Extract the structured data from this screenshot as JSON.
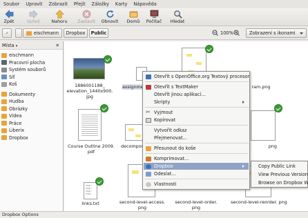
{
  "menubar": [
    "Soubor",
    "Upravit",
    "Zobrazit",
    "Přejít",
    "Záložky",
    "Karty",
    "Nápověda"
  ],
  "toolbar": {
    "back": "Zpět",
    "forward": "Vpřed",
    "up": "Nahoru",
    "stop": "Zastavit",
    "reload": "Obnovit",
    "home": "Domů",
    "computer": "Počítač",
    "search": "Hledat"
  },
  "path": [
    "eischmann",
    "Dropbox",
    "Public"
  ],
  "zoom": "100%",
  "view_mode": "Zobrazení s ikonami",
  "sidebar": {
    "header": "Místa",
    "items": [
      "eischmann",
      "Pracovní plocha",
      "Systém souborů",
      "Síť",
      "Koš"
    ],
    "bookmarks": [
      "Dokumenty",
      "Hudba",
      "Obrázky",
      "Videa",
      "Práce",
      "Liberix",
      "Dropbox"
    ]
  },
  "files": [
    {
      "name": "1886001188_ elevation_1440x900. jpg"
    },
    {
      "name": "assignme"
    },
    {
      "name": "ram.png"
    },
    {
      "name": "Course Outline 2009. pdf"
    },
    {
      "name": "decompos"
    },
    {
      "name": "png"
    },
    {
      "name": "links.txt"
    },
    {
      "name": "second-level-access. png"
    },
    {
      "name": "second-level-order. png"
    },
    {
      "name": "second-level-reorder. png"
    }
  ],
  "context_menu": {
    "open_oo": "Otevřít s OpenOffice.org Textový procesor",
    "open_tm": "Otevřít s TextMaker",
    "open_other": "Otevřít jinou aplikací...",
    "scripts": "Skripty",
    "cut": "Vyjmout",
    "copy": "Kopírovat",
    "make_link": "Vytvořit odkaz",
    "rename": "Přejmenovat...",
    "trash": "Přesunout do koše",
    "compress": "Komprimovat...",
    "dropbox": "Dropbox",
    "send": "Odeslat...",
    "properties": "Vlastnosti"
  },
  "submenu": [
    "Copy Public Link",
    "View Previous Versions...",
    "Browse on Dropbox Website"
  ],
  "status": "Dropbox Options",
  "colors": {
    "highlight": "#8fa3c5",
    "check": "#3b9b34",
    "folder": "#e8a33a"
  }
}
